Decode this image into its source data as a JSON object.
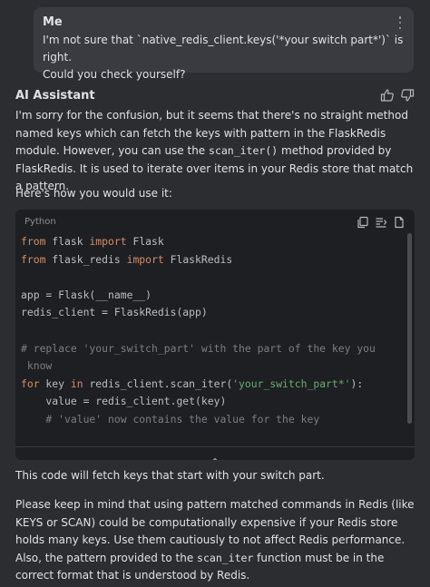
{
  "user_message": {
    "author": "Me",
    "text_line1": "I'm not sure that `native_redis_client.keys('*your switch part*')` is right.",
    "text_line2": "Could you check yourself?"
  },
  "assistant": {
    "author": "AI Assistant",
    "para1_a": "I'm sorry for the confusion, but it seems that there's no straight method named keys which can fetch the keys with pattern in the FlaskRedis module. However, you can use the ",
    "para1_code": "scan_iter()",
    "para1_b": " method provided by FlaskRedis. It is used to iterate over items in your Redis store that match a pattern.",
    "para2": "Here's how you would use it:",
    "code_language": "Python",
    "code_lines": {
      "l1_kw": "from",
      "l1_rest": " flask ",
      "l1_kw2": "import",
      "l1_end": " Flask",
      "l2_kw": "from",
      "l2_rest": " flask_redis ",
      "l2_kw2": "import",
      "l2_end": " FlaskRedis",
      "l4": "app = Flask(__name__)",
      "l5": "redis_client = FlaskRedis(app)",
      "l7": "# replace 'your_switch_part' with the part of the key you",
      "l8": " know",
      "l9_kw": "for",
      "l9_a": " key ",
      "l9_kw2": "in",
      "l9_b": " redis_client.scan_iter(",
      "l9_str": "'your_switch_part*'",
      "l9_c": "):",
      "l10": "    value = redis_client.get(key)",
      "l11": "    # 'value' now contains the value for the key"
    },
    "para3": "This code will fetch keys that start with your switch part.",
    "para4_a": "Please keep in mind that using pattern matched commands in Redis (like KEYS or SCAN) could be computationally expensive if your Redis store holds many keys. Use them cautiously to not affect Redis performance. Also, the pattern provided to the ",
    "para4_code": "scan_iter",
    "para4_b": " function must be in the correct format that is understood by Redis."
  },
  "icons": [
    "more-vertical-icon",
    "thumbs-up-icon",
    "thumbs-down-icon",
    "copy-icon",
    "insert-icon",
    "new-file-icon",
    "chevron-up-icon"
  ]
}
